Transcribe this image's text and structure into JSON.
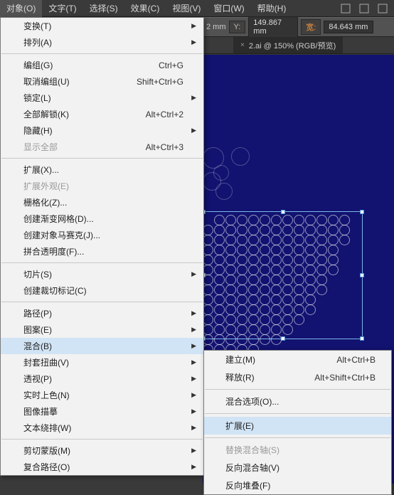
{
  "menubar": [
    "对象(O)",
    "文字(T)",
    "选择(S)",
    "效果(C)",
    "视图(V)",
    "窗口(W)",
    "帮助(H)"
  ],
  "menubar_active_index": 0,
  "options": {
    "y_label": "Y:",
    "y_value": "149.867",
    "y_unit": "mm",
    "w_label": "宽:",
    "w_value": "84.643",
    "w_unit": "mm",
    "x_suffix": "2 mm"
  },
  "tab": {
    "title": "2.ai @ 150% (RGB/预览)"
  },
  "menu": {
    "sections": [
      [
        {
          "label": "变换(T)",
          "sub": true
        },
        {
          "label": "排列(A)",
          "sub": true
        }
      ],
      [
        {
          "label": "编组(G)",
          "shortcut": "Ctrl+G"
        },
        {
          "label": "取消编组(U)",
          "shortcut": "Shift+Ctrl+G"
        },
        {
          "label": "锁定(L)",
          "sub": true
        },
        {
          "label": "全部解锁(K)",
          "shortcut": "Alt+Ctrl+2"
        },
        {
          "label": "隐藏(H)",
          "sub": true
        },
        {
          "label": "显示全部",
          "shortcut": "Alt+Ctrl+3",
          "disabled": true
        }
      ],
      [
        {
          "label": "扩展(X)..."
        },
        {
          "label": "扩展外观(E)",
          "disabled": true
        },
        {
          "label": "栅格化(Z)..."
        },
        {
          "label": "创建渐变网格(D)..."
        },
        {
          "label": "创建对象马赛克(J)..."
        },
        {
          "label": "拼合透明度(F)..."
        }
      ],
      [
        {
          "label": "切片(S)",
          "sub": true
        },
        {
          "label": "创建裁切标记(C)"
        }
      ],
      [
        {
          "label": "路径(P)",
          "sub": true
        },
        {
          "label": "图案(E)",
          "sub": true
        },
        {
          "label": "混合(B)",
          "sub": true,
          "hl": true
        },
        {
          "label": "封套扭曲(V)",
          "sub": true
        },
        {
          "label": "透视(P)",
          "sub": true
        },
        {
          "label": "实时上色(N)",
          "sub": true
        },
        {
          "label": "图像描摹",
          "sub": true
        },
        {
          "label": "文本绕排(W)",
          "sub": true
        }
      ],
      [
        {
          "label": "剪切蒙版(M)",
          "sub": true
        },
        {
          "label": "复合路径(O)",
          "sub": true
        }
      ]
    ]
  },
  "submenu": {
    "sections": [
      [
        {
          "label": "建立(M)",
          "shortcut": "Alt+Ctrl+B"
        },
        {
          "label": "释放(R)",
          "shortcut": "Alt+Shift+Ctrl+B"
        }
      ],
      [
        {
          "label": "混合选项(O)..."
        }
      ],
      [
        {
          "label": "扩展(E)",
          "hl": true
        }
      ],
      [
        {
          "label": "替换混合轴(S)",
          "disabled": true
        },
        {
          "label": "反向混合轴(V)"
        },
        {
          "label": "反向堆叠(F)"
        }
      ]
    ]
  }
}
